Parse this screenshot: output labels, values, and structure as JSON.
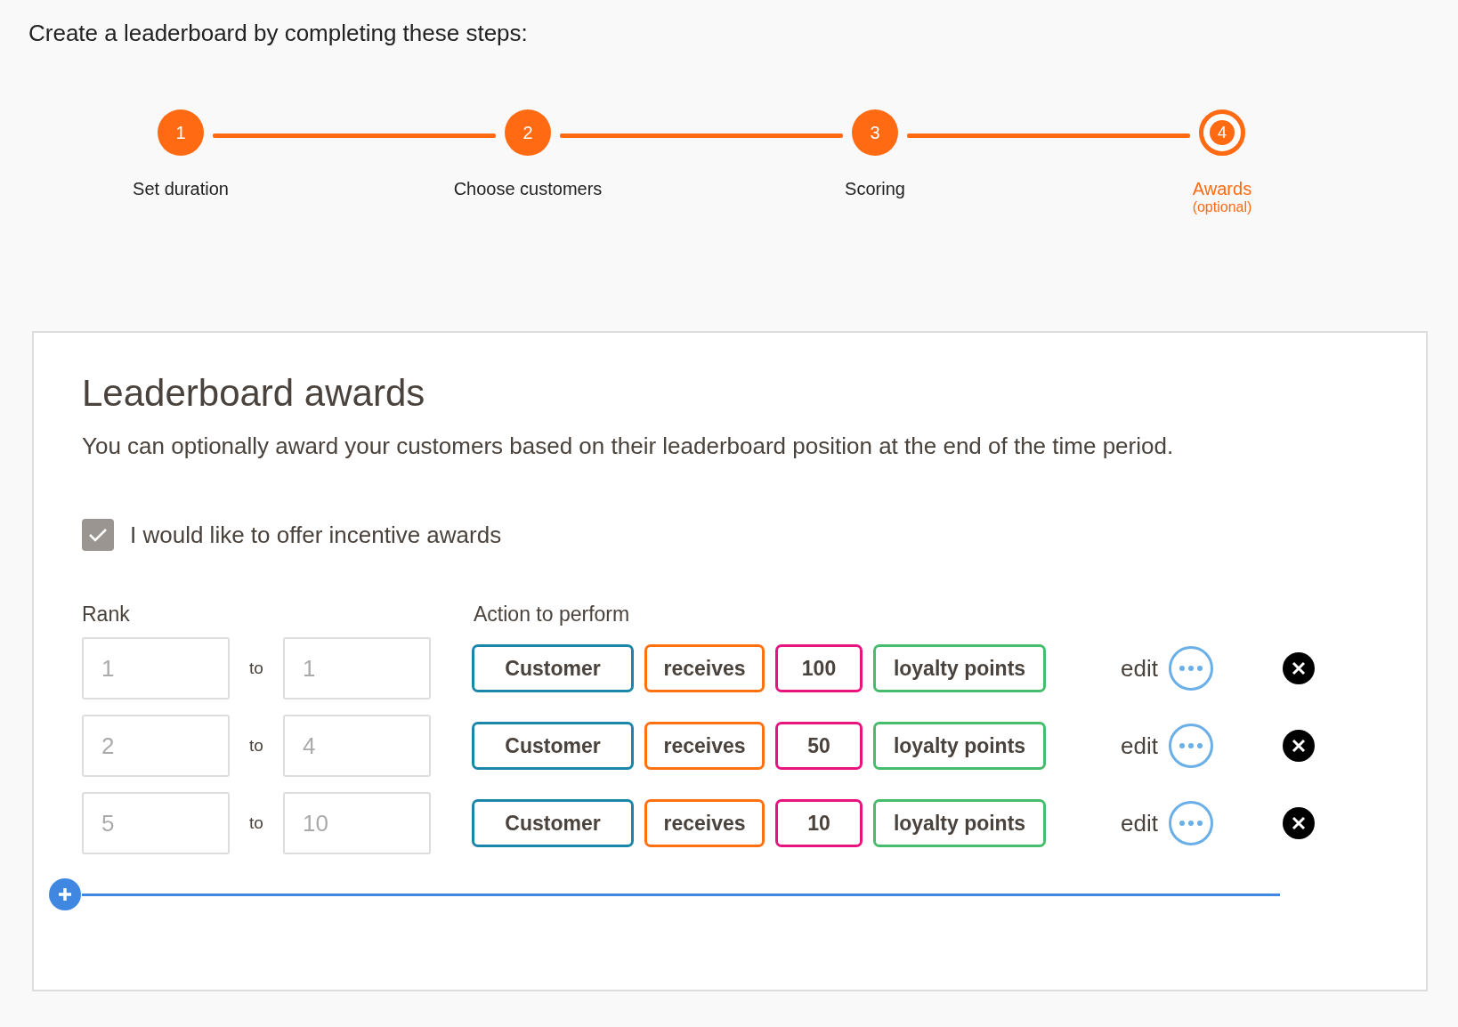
{
  "heading": "Create a leaderboard by completing these steps:",
  "steps": [
    {
      "number": "1",
      "label": "Set duration",
      "selected": false
    },
    {
      "number": "2",
      "label": "Choose customers",
      "selected": false
    },
    {
      "number": "3",
      "label": "Scoring",
      "selected": false
    },
    {
      "number": "4",
      "label": "Awards",
      "note": "(optional)",
      "selected": true
    }
  ],
  "card": {
    "title": "Leaderboard awards",
    "description": "You can optionally award your customers based on their leaderboard position at the end of the time period.",
    "incentive": {
      "label": "I would like to offer incentive awards",
      "checked": true
    },
    "rank_header": "Rank",
    "action_header": "Action to perform",
    "rows": [
      {
        "from": "1",
        "separator": "to",
        "to": "1",
        "chips": [
          {
            "text": "Customer",
            "color": "#1a86a8"
          },
          {
            "text": "receives",
            "color": "#ff7010"
          },
          {
            "text": "100",
            "color": "#e8137e"
          },
          {
            "text": "loyalty points",
            "color": "#46bd6c"
          }
        ],
        "edit": "edit"
      },
      {
        "from": "2",
        "separator": "to",
        "to": "4",
        "chips": [
          {
            "text": "Customer",
            "color": "#1a86a8"
          },
          {
            "text": "receives",
            "color": "#ff7010"
          },
          {
            "text": "50",
            "color": "#e8137e"
          },
          {
            "text": "loyalty points",
            "color": "#46bd6c"
          }
        ],
        "edit": "edit"
      },
      {
        "from": "5",
        "separator": "to",
        "to": "10",
        "chips": [
          {
            "text": "Customer",
            "color": "#1a86a8"
          },
          {
            "text": "receives",
            "color": "#ff7010"
          },
          {
            "text": "10",
            "color": "#e8137e"
          },
          {
            "text": "loyalty points",
            "color": "#46bd6c"
          }
        ],
        "edit": "edit"
      }
    ]
  }
}
